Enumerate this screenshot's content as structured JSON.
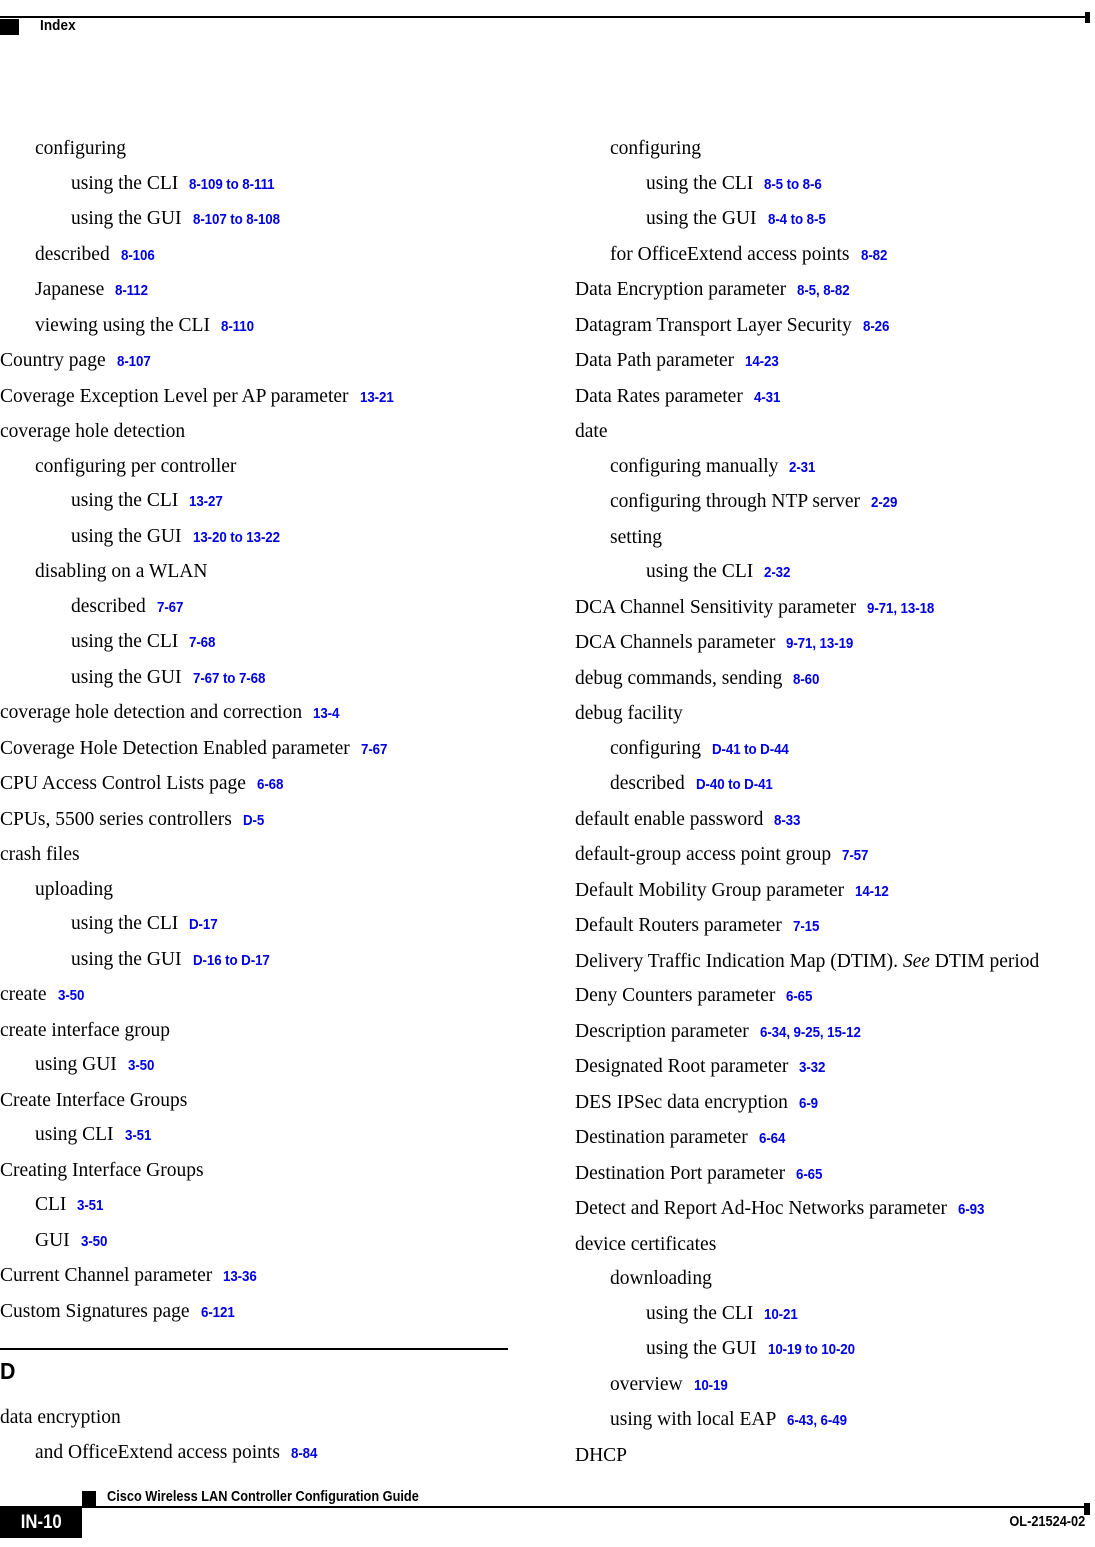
{
  "header": {
    "title": "Index",
    "marker_icon": "black-square-marker-icon"
  },
  "footer": {
    "guide_title": "Cisco Wireless LAN Controller Configuration Guide",
    "page_number": "IN-10",
    "doc_id": "OL-21524-02",
    "marker_icon": "black-square-marker-icon"
  },
  "columns": {
    "left": {
      "entries": [
        {
          "level": 1,
          "term": "configuring",
          "pages": ""
        },
        {
          "level": 2,
          "term": "using the CLI",
          "pages": "8-109 to 8-111"
        },
        {
          "level": 2,
          "term": "using the GUI",
          "pages": "8-107 to 8-108"
        },
        {
          "level": 1,
          "term": "described",
          "pages": "8-106"
        },
        {
          "level": 1,
          "term": "Japanese",
          "pages": "8-112"
        },
        {
          "level": 1,
          "term": "viewing using the CLI",
          "pages": "8-110"
        },
        {
          "level": 0,
          "term": "Country page",
          "pages": "8-107"
        },
        {
          "level": 0,
          "term": "Coverage Exception Level per AP parameter",
          "pages": "13-21"
        },
        {
          "level": 0,
          "term": "coverage hole detection",
          "pages": ""
        },
        {
          "level": 1,
          "term": "configuring per controller",
          "pages": ""
        },
        {
          "level": 2,
          "term": "using the CLI",
          "pages": "13-27"
        },
        {
          "level": 2,
          "term": "using the GUI",
          "pages": "13-20 to 13-22"
        },
        {
          "level": 1,
          "term": "disabling on a WLAN",
          "pages": ""
        },
        {
          "level": 2,
          "term": "described",
          "pages": "7-67"
        },
        {
          "level": 2,
          "term": "using the CLI",
          "pages": "7-68"
        },
        {
          "level": 2,
          "term": "using the GUI",
          "pages": "7-67 to 7-68"
        },
        {
          "level": 0,
          "term": "coverage hole detection and correction",
          "pages": "13-4"
        },
        {
          "level": 0,
          "term": "Coverage Hole Detection Enabled parameter",
          "pages": "7-67"
        },
        {
          "level": 0,
          "term": "CPU Access Control Lists page",
          "pages": "6-68"
        },
        {
          "level": 0,
          "term": "CPUs, 5500 series controllers",
          "pages": "D-5"
        },
        {
          "level": 0,
          "term": "crash files",
          "pages": ""
        },
        {
          "level": 1,
          "term": "uploading",
          "pages": ""
        },
        {
          "level": 2,
          "term": "using the CLI",
          "pages": "D-17"
        },
        {
          "level": 2,
          "term": "using the GUI",
          "pages": "D-16 to D-17"
        },
        {
          "level": 0,
          "term": "create",
          "pages": "3-50"
        },
        {
          "level": 0,
          "term": "create interface group",
          "pages": ""
        },
        {
          "level": 1,
          "term": "using GUI",
          "pages": "3-50"
        },
        {
          "level": 0,
          "term": "Create Interface Groups",
          "pages": ""
        },
        {
          "level": 1,
          "term": "using CLI",
          "pages": "3-51"
        },
        {
          "level": 0,
          "term": "Creating Interface Groups",
          "pages": ""
        },
        {
          "level": 1,
          "term": "CLI",
          "pages": "3-51"
        },
        {
          "level": 1,
          "term": "GUI",
          "pages": "3-50"
        },
        {
          "level": 0,
          "term": "Current Channel parameter",
          "pages": "13-36"
        },
        {
          "level": 0,
          "term": "Custom Signatures page",
          "pages": "6-121"
        }
      ],
      "letter_section": {
        "letter": "D",
        "entries": [
          {
            "level": 0,
            "term": "data encryption",
            "pages": ""
          },
          {
            "level": 1,
            "term": "and OfficeExtend access points",
            "pages": "8-84"
          }
        ]
      }
    },
    "right": {
      "entries": [
        {
          "level": 1,
          "term": "configuring",
          "pages": ""
        },
        {
          "level": 2,
          "term": "using the CLI",
          "pages": "8-5 to 8-6"
        },
        {
          "level": 2,
          "term": "using the GUI",
          "pages": "8-4 to 8-5"
        },
        {
          "level": 1,
          "term": "for OfficeExtend access points",
          "pages": "8-82"
        },
        {
          "level": 0,
          "term": "Data Encryption parameter",
          "pages": "8-5, 8-82"
        },
        {
          "level": 0,
          "term": "Datagram Transport Layer Security",
          "pages": "8-26"
        },
        {
          "level": 0,
          "term": "Data Path parameter",
          "pages": "14-23"
        },
        {
          "level": 0,
          "term": "Data Rates parameter",
          "pages": "4-31"
        },
        {
          "level": 0,
          "term": "date",
          "pages": ""
        },
        {
          "level": 1,
          "term": "configuring manually",
          "pages": "2-31"
        },
        {
          "level": 1,
          "term": "configuring through NTP server",
          "pages": "2-29"
        },
        {
          "level": 1,
          "term": "setting",
          "pages": ""
        },
        {
          "level": 2,
          "term": "using the CLI",
          "pages": "2-32"
        },
        {
          "level": 0,
          "term": "DCA Channel Sensitivity parameter",
          "pages": "9-71, 13-18"
        },
        {
          "level": 0,
          "term": "DCA Channels parameter",
          "pages": "9-71, 13-19"
        },
        {
          "level": 0,
          "term": "debug commands, sending",
          "pages": "8-60"
        },
        {
          "level": 0,
          "term": "debug facility",
          "pages": ""
        },
        {
          "level": 1,
          "term": "configuring",
          "pages": "D-41 to D-44"
        },
        {
          "level": 1,
          "term": "described",
          "pages": "D-40 to D-41"
        },
        {
          "level": 0,
          "term": "default enable password",
          "pages": "8-33"
        },
        {
          "level": 0,
          "term": "default-group access point group",
          "pages": "7-57"
        },
        {
          "level": 0,
          "term": "Default Mobility Group parameter",
          "pages": "14-12"
        },
        {
          "level": 0,
          "term": "Default Routers parameter",
          "pages": "7-15"
        },
        {
          "level": 0,
          "term": "Delivery Traffic Indication Map (DTIM). <em>See</em> DTIM period",
          "pages": "",
          "html": true
        },
        {
          "level": 0,
          "term": "Deny Counters parameter",
          "pages": "6-65"
        },
        {
          "level": 0,
          "term": "Description parameter",
          "pages": "6-34, 9-25, 15-12"
        },
        {
          "level": 0,
          "term": "Designated Root parameter",
          "pages": "3-32"
        },
        {
          "level": 0,
          "term": "DES IPSec data encryption",
          "pages": "6-9"
        },
        {
          "level": 0,
          "term": "Destination parameter",
          "pages": "6-64"
        },
        {
          "level": 0,
          "term": "Destination Port parameter",
          "pages": "6-65"
        },
        {
          "level": 0,
          "term": "Detect and Report Ad-Hoc Networks parameter",
          "pages": "6-93"
        },
        {
          "level": 0,
          "term": "device certificates",
          "pages": ""
        },
        {
          "level": 1,
          "term": "downloading",
          "pages": ""
        },
        {
          "level": 2,
          "term": "using the CLI",
          "pages": "10-21"
        },
        {
          "level": 2,
          "term": "using the GUI",
          "pages": "10-19 to 10-20"
        },
        {
          "level": 1,
          "term": "overview",
          "pages": "10-19"
        },
        {
          "level": 1,
          "term": "using with local EAP",
          "pages": "6-43, 6-49"
        },
        {
          "level": 0,
          "term": "DHCP",
          "pages": ""
        }
      ]
    }
  },
  "colors": {
    "page_reference": "#0000E6",
    "text": "#000000",
    "background": "#ffffff"
  }
}
